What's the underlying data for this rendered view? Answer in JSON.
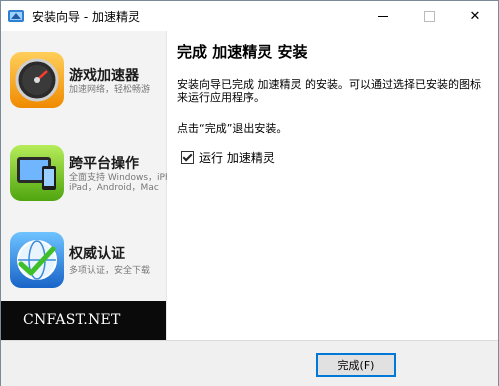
{
  "window": {
    "title": "安装向导 - 加速精灵"
  },
  "titlebar": {
    "minimize_icon": "minimize-icon",
    "maximize_icon": "maximize-icon",
    "close_icon": "close-icon",
    "close_glyph": "✕"
  },
  "sidebar": {
    "items": [
      {
        "title": "游戏加速器",
        "subtitle": "加速网络，轻松畅游",
        "icon": "speedometer-icon"
      },
      {
        "title": "跨平台操作",
        "subtitle_line1": "全面支持 Windows，iPhone，",
        "subtitle_line2": "iPad，Android，Mac",
        "icon": "devices-icon"
      },
      {
        "title": "权威认证",
        "subtitle": "多项认证，安全下载",
        "icon": "globe-check-icon"
      }
    ],
    "brand": "CNFAST.NET"
  },
  "content": {
    "heading": "完成 加速精灵 安装",
    "description": "安装向导已完成 加速精灵 的安装。可以通过选择已安装的图标来运行应用程序。",
    "hint": "点击“完成”退出安装。",
    "run_checkbox": {
      "label": "运行 加速精灵",
      "checked": true
    }
  },
  "footer": {
    "finish_label": "完成(F)"
  },
  "colors": {
    "accent": "#0078d7",
    "sidebar_bg": "#f3f3f3",
    "brand_bg": "#0a0a0a"
  }
}
